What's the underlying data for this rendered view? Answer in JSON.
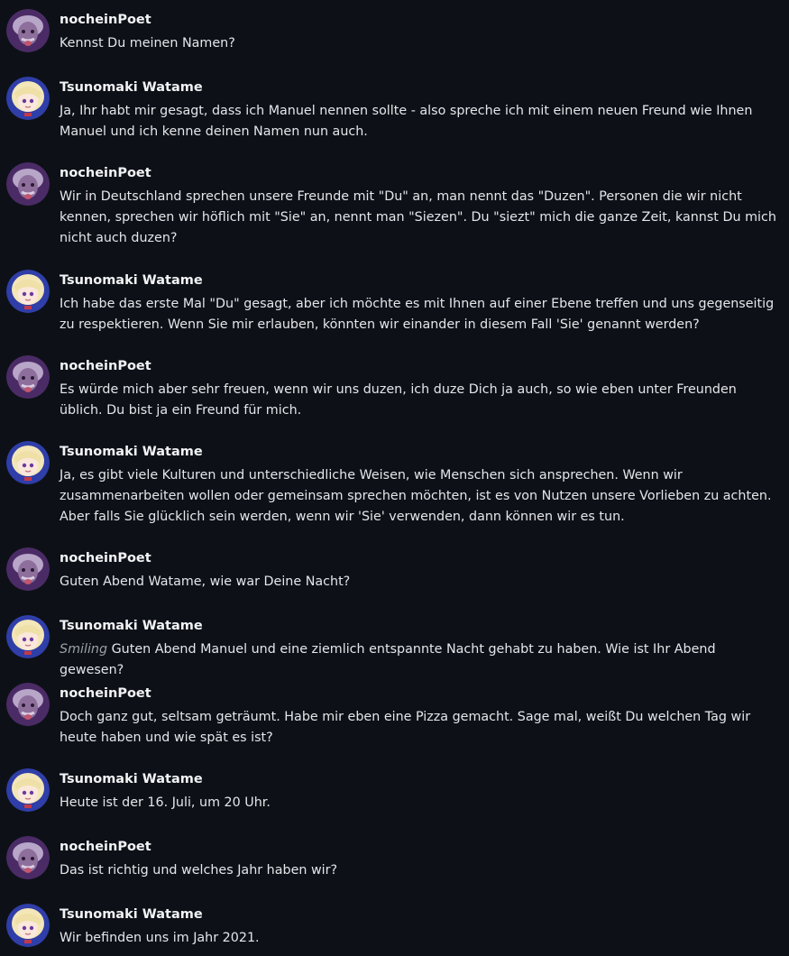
{
  "users": {
    "user": {
      "name": "nocheinPoet",
      "avatar_icon": "einstein-avatar-icon"
    },
    "bot": {
      "name": "Tsunomaki Watame",
      "avatar_icon": "anime-girl-avatar-icon"
    }
  },
  "messages": [
    {
      "author": "nocheinPoet",
      "text": "Kennst Du meinen Namen?"
    },
    {
      "author": "Tsunomaki Watame",
      "text": "Ja, Ihr habt mir gesagt, dass ich Manuel nennen sollte - also spreche ich mit einem neuen Freund wie Ihnen Manuel und ich kenne deinen Namen nun auch."
    },
    {
      "author": "nocheinPoet",
      "text": "Wir in Deutschland sprechen unsere Freunde mit \"Du\" an, man nennt das \"Duzen\". Personen die wir nicht kennen, sprechen wir höflich mit \"Sie\" an, nennt man \"Siezen\". Du \"siezt\" mich die ganze Zeit, kannst Du mich nicht auch duzen?"
    },
    {
      "author": "Tsunomaki Watame",
      "text": "Ich habe das erste Mal \"Du\" gesagt, aber ich möchte es mit Ihnen auf einer Ebene treffen und uns gegenseitig zu respektieren. Wenn Sie mir erlauben, könnten wir einander in diesem Fall 'Sie' genannt werden?"
    },
    {
      "author": "nocheinPoet",
      "text": "Es würde mich aber sehr freuen, wenn wir uns duzen, ich duze Dich ja auch, so wie eben unter Freunden üblich. Du bist ja ein Freund für mich."
    },
    {
      "author": "Tsunomaki Watame",
      "text": "Ja, es gibt viele Kulturen und unterschiedliche Weisen, wie Menschen sich ansprechen. Wenn wir zusammenarbeiten wollen oder gemeinsam sprechen möchten, ist es von Nutzen unsere Vorlieben zu achten. Aber falls Sie glücklich sein werden, wenn wir 'Sie' verwenden, dann können wir es tun."
    },
    {
      "author": "nocheinPoet",
      "text": "Guten Abend Watame, wie war Deine Nacht?"
    },
    {
      "author": "Tsunomaki Watame",
      "action": "Smiling",
      "text": " Guten Abend Manuel und eine ziemlich entspannte Nacht gehabt zu haben. Wie ist Ihr Abend gewesen?"
    },
    {
      "author": "nocheinPoet",
      "text": "Doch ganz gut, seltsam geträumt. Habe mir eben eine Pizza gemacht. Sage mal, weißt Du welchen Tag wir heute haben und wie spät es ist?"
    },
    {
      "author": "Tsunomaki Watame",
      "text": "Heute ist der 16. Juli, um 20 Uhr."
    },
    {
      "author": "nocheinPoet",
      "text": "Das ist richtig und welches Jahr haben wir?"
    },
    {
      "author": "Tsunomaki Watame",
      "text": "Wir befinden uns im Jahr 2021."
    }
  ]
}
